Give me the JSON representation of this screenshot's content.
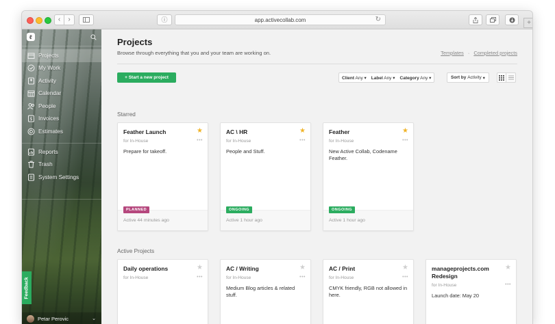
{
  "browser": {
    "url": "app.activecollab.com",
    "icons": {
      "back": "chevron-left-icon",
      "forward": "chevron-right-icon",
      "reload": "reload-icon",
      "share": "share-icon",
      "tabs": "tabs-icon",
      "download": "download-icon",
      "new_tab": "plus-icon"
    }
  },
  "sidebar": {
    "items": [
      {
        "label": "Projects",
        "icon": "projects-icon",
        "active": true
      },
      {
        "label": "My Work",
        "icon": "check-circle-icon",
        "active": false
      },
      {
        "label": "Activity",
        "icon": "activity-icon",
        "active": false
      },
      {
        "label": "Calendar",
        "icon": "calendar-icon",
        "active": false
      },
      {
        "label": "People",
        "icon": "people-icon",
        "active": false
      },
      {
        "label": "Invoices",
        "icon": "invoice-icon",
        "active": false
      },
      {
        "label": "Estimates",
        "icon": "estimates-icon",
        "active": false
      }
    ],
    "items2": [
      {
        "label": "Reports",
        "icon": "reports-icon"
      },
      {
        "label": "Trash",
        "icon": "trash-icon"
      },
      {
        "label": "System Settings",
        "icon": "settings-icon"
      }
    ],
    "feedback_label": "Feedback",
    "user_name": "Petar Perovic"
  },
  "main": {
    "title": "Projects",
    "subtitle": "Browse through everything that you and your team are working on.",
    "link_templates": "Templates",
    "link_separator": "·",
    "link_completed": "Completed projects",
    "new_project_label": "+ Start a new project",
    "filters": {
      "client_label": "Client",
      "client_value": "Any",
      "label_label": "Label",
      "label_value": "Any",
      "category_label": "Category",
      "category_value": "Any"
    },
    "sort_label": "Sort by",
    "sort_value": "Activity",
    "starred_label": "Starred",
    "active_label": "Active Projects",
    "starred": [
      {
        "title": "Feather Launch",
        "client": "for In-House",
        "desc": "Prepare for takeoff.",
        "badge": "PLANNED",
        "activity": "Active 44 minutes ago",
        "starred": true
      },
      {
        "title": "AC \\ HR",
        "client": "for In-House",
        "desc": "People and Stuff.",
        "badge": "ONGOING",
        "activity": "Active 1 hour ago",
        "starred": true
      },
      {
        "title": "Feather",
        "client": "for In-House",
        "desc": "New Active Collab, Codename Feather.",
        "badge": "ONGOING",
        "activity": "Active 1 hour ago",
        "starred": true
      }
    ],
    "active": [
      {
        "title": "Daily operations",
        "client": "for In-House",
        "desc": "",
        "starred": false
      },
      {
        "title": "AC / Writing",
        "client": "for In-House",
        "desc": "Medium Blog articles & related stuff.",
        "starred": false
      },
      {
        "title": "AC / Print",
        "client": "for In-House",
        "desc": "CMYK friendly, RGB not allowed in here.",
        "starred": false
      },
      {
        "title": "manageprojects.com Redesign",
        "client": "for In-House",
        "desc": "Launch date: May 20",
        "starred": false
      }
    ],
    "card_more": "•••"
  },
  "colors": {
    "accent_green": "#2bac5f",
    "planned": "#b5477d",
    "star": "#f0b429"
  }
}
